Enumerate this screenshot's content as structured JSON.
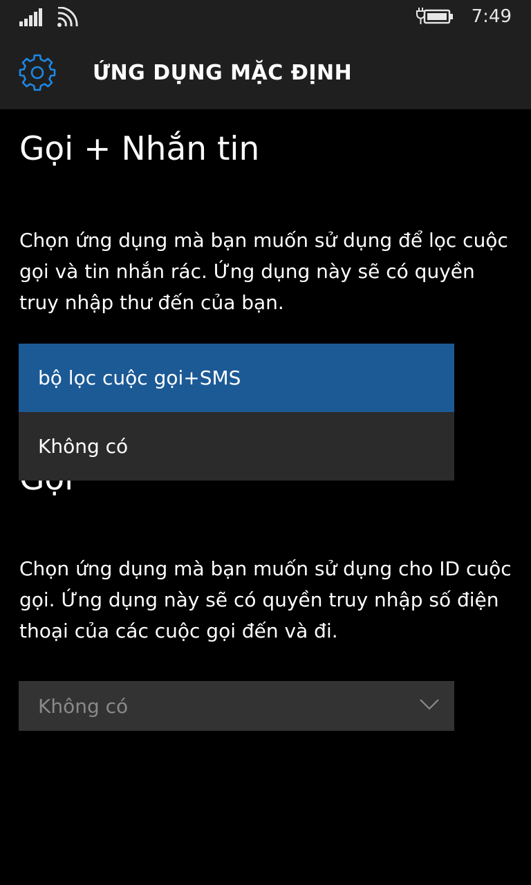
{
  "status_bar": {
    "time": "7:49",
    "signal_icon": "signal-bars-icon",
    "wifi_icon": "wifi-icon",
    "battery_icon": "battery-charging-icon"
  },
  "header": {
    "icon": "gear-icon",
    "title": "ỨNG DỤNG MẶC ĐỊNH"
  },
  "sections": [
    {
      "heading": "Gọi + Nhắn tin",
      "description": "Chọn ứng dụng mà bạn muốn sử dụng để lọc cuộc gọi và tin nhắn rác. Ứng dụng này sẽ có quyền truy nhập thư đến của bạn.",
      "dropdown": {
        "state": "open",
        "options": [
          "bộ lọc cuộc gọi+SMS",
          "Không có"
        ],
        "selected": "bộ lọc cuộc gọi+SMS"
      }
    },
    {
      "heading": "Gọi",
      "description": "Chọn ứng dụng mà bạn muốn sử dụng cho ID cuộc gọi. Ứng dụng này sẽ có quyền truy nhập số điện thoại của các cuộc gọi đến và đi.",
      "dropdown": {
        "state": "closed",
        "value": "Không có",
        "icon": "chevron-down-icon"
      }
    }
  ],
  "colors": {
    "accent": "#1c5a96",
    "background": "#000000",
    "header_background": "#1f1f1f",
    "dropdown_background": "#2b2b2b",
    "disabled_text": "#8a8a8a"
  }
}
